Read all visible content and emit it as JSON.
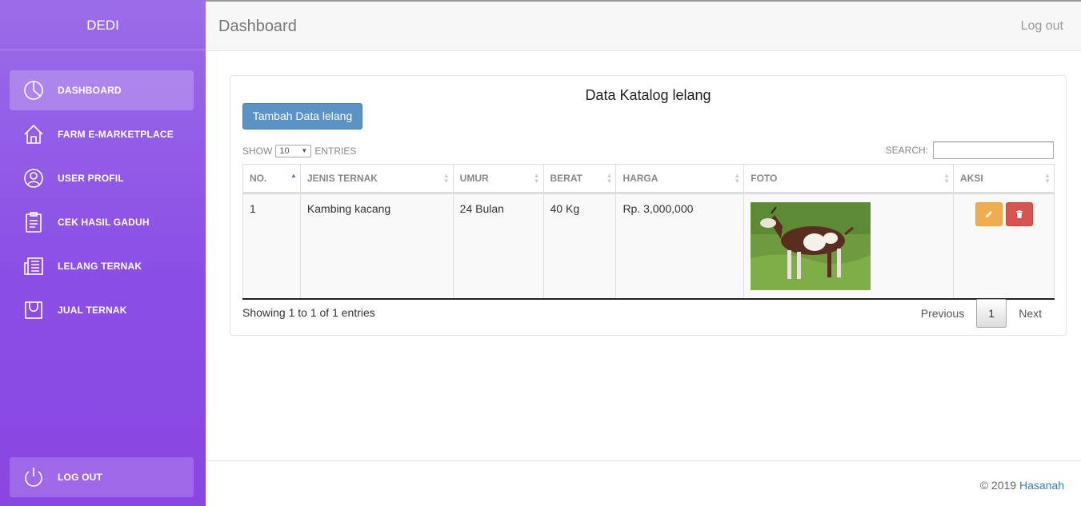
{
  "sidebar": {
    "brand": "DEDI",
    "items": [
      {
        "label": "DASHBOARD",
        "icon": "pie-chart-icon",
        "active": true
      },
      {
        "label": "FARM E-MARKETPLACE",
        "icon": "home-icon",
        "active": false
      },
      {
        "label": "USER PROFIL",
        "icon": "user-icon",
        "active": false
      },
      {
        "label": "CEK HASIL GADUH",
        "icon": "clipboard-icon",
        "active": false
      },
      {
        "label": "LELANG TERNAK",
        "icon": "newspaper-icon",
        "active": false
      },
      {
        "label": "JUAL TERNAK",
        "icon": "bag-icon",
        "active": false
      }
    ],
    "logout": {
      "label": "LOG OUT",
      "icon": "power-icon"
    }
  },
  "topbar": {
    "title": "Dashboard",
    "logout": "Log out"
  },
  "card": {
    "title": "Data Katalog lelang",
    "add_button": "Tambah Data lelang",
    "length": {
      "prefix": "SHOW",
      "value": "10",
      "suffix": "ENTRIES"
    },
    "search": {
      "label": "SEARCH:",
      "value": ""
    },
    "columns": [
      "NO.",
      "JENIS TERNAK",
      "UMUR",
      "BERAT",
      "HARGA",
      "FOTO",
      "AKSI"
    ],
    "sorted_column": "NO.",
    "rows": [
      {
        "no": "1",
        "jenis": "Kambing kacang",
        "umur": "24 Bulan",
        "berat": "40 Kg",
        "harga": "Rp. 3,000,000",
        "foto": "goat-photo"
      }
    ],
    "info": "Showing 1 to 1 of 1 entries",
    "pagination": {
      "previous": "Previous",
      "current": "1",
      "next": "Next"
    }
  },
  "footer": {
    "text": "© 2019 ",
    "link": "Hasanah"
  },
  "colors": {
    "sidebar_top": "#9b6ce8",
    "sidebar_bottom": "#8a46e2",
    "primary_button": "#5b93c6",
    "edit": "#f0ad4e",
    "delete": "#d9534f",
    "footer_link": "#3a7cc2"
  }
}
